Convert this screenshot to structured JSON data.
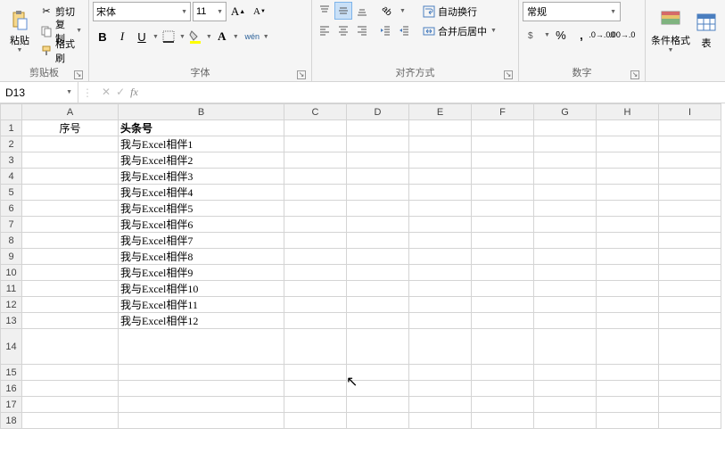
{
  "ribbon": {
    "clipboard": {
      "label": "剪贴板",
      "paste": "粘贴",
      "cut": "剪切",
      "copy": "复制",
      "format_painter": "格式刷"
    },
    "font": {
      "label": "字体",
      "name": "宋体",
      "size": "11",
      "bold": "B",
      "italic": "I",
      "underline": "U",
      "pinyin": "wén"
    },
    "alignment": {
      "label": "对齐方式",
      "wrap": "自动换行",
      "merge": "合并后居中"
    },
    "number": {
      "label": "数字",
      "format": "常规",
      "percent": "%",
      "comma": ","
    },
    "styles": {
      "conditional": "条件格式",
      "table_styles": "表"
    }
  },
  "namebox": "D13",
  "formula": "",
  "columns": [
    "A",
    "B",
    "C",
    "D",
    "E",
    "F",
    "G",
    "H",
    "I"
  ],
  "sheet": {
    "header_a": "序号",
    "header_b": "头条号",
    "rows": [
      "我与Excel相伴1",
      "我与Excel相伴2",
      "我与Excel相伴3",
      "我与Excel相伴4",
      "我与Excel相伴5",
      "我与Excel相伴6",
      "我与Excel相伴7",
      "我与Excel相伴8",
      "我与Excel相伴9",
      "我与Excel相伴10",
      "我与Excel相伴11",
      "我与Excel相伴12"
    ]
  },
  "chart_data": {
    "type": "table",
    "columns": [
      "序号",
      "头条号"
    ],
    "rows": [
      [
        null,
        "我与Excel相伴1"
      ],
      [
        null,
        "我与Excel相伴2"
      ],
      [
        null,
        "我与Excel相伴3"
      ],
      [
        null,
        "我与Excel相伴4"
      ],
      [
        null,
        "我与Excel相伴5"
      ],
      [
        null,
        "我与Excel相伴6"
      ],
      [
        null,
        "我与Excel相伴7"
      ],
      [
        null,
        "我与Excel相伴8"
      ],
      [
        null,
        "我与Excel相伴9"
      ],
      [
        null,
        "我与Excel相伴10"
      ],
      [
        null,
        "我与Excel相伴11"
      ],
      [
        null,
        "我与Excel相伴12"
      ]
    ]
  }
}
